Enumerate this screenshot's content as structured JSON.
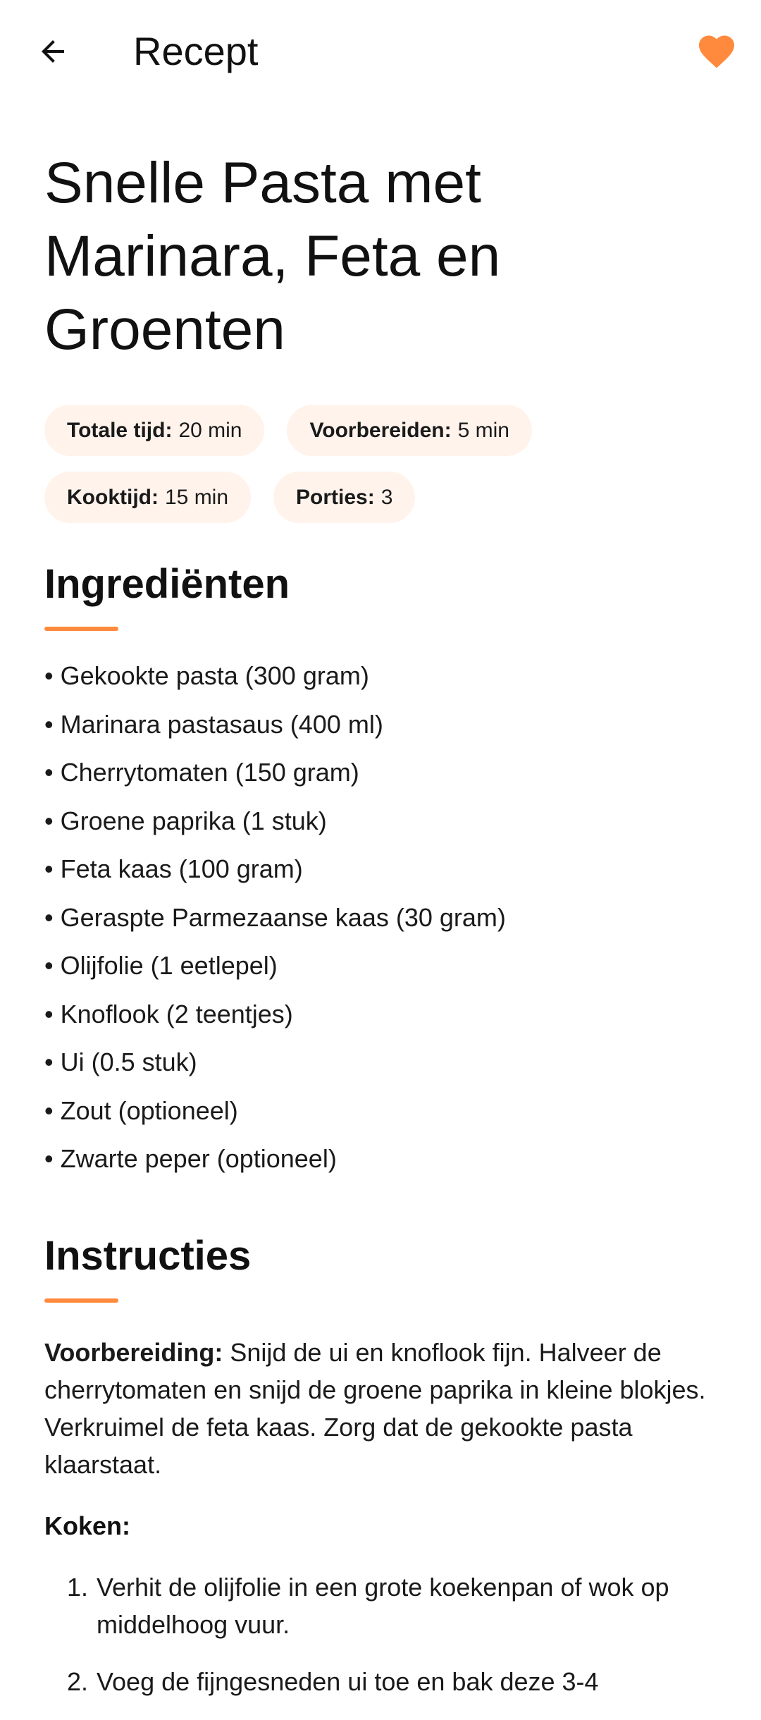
{
  "app_bar": {
    "title": "Recept",
    "back_icon": "arrow-left-icon",
    "favorite_icon": "heart-icon",
    "accent_color": "#ff8a3d"
  },
  "recipe": {
    "title": "Snelle Pasta met Marinara, Feta en Groenten"
  },
  "chips": [
    {
      "label": "Totale tijd:",
      "value": "20 min"
    },
    {
      "label": "Voorbereiden:",
      "value": "5 min"
    },
    {
      "label": "Kooktijd:",
      "value": "15 min"
    },
    {
      "label": "Porties:",
      "value": "3"
    }
  ],
  "ingredients": {
    "heading": "Ingrediënten",
    "bullet": "•",
    "items": [
      "Gekookte pasta (300 gram)",
      "Marinara pastasaus (400 ml)",
      "Cherrytomaten (150 gram)",
      "Groene paprika (1 stuk)",
      "Feta kaas (100 gram)",
      "Geraspte Parmezaanse kaas (30 gram)",
      "Olijfolie (1 eetlepel)",
      "Knoflook (2 teentjes)",
      "Ui (0.5 stuk)",
      "Zout (optioneel)",
      "Zwarte peper (optioneel)"
    ]
  },
  "instructions": {
    "heading": "Instructies",
    "preparation_label": "Voorbereiding:",
    "preparation_text": "Snijd de ui en knoflook fijn. Halveer de cherrytomaten en snijd de groene paprika in kleine blokjes. Verkruimel de feta kaas. Zorg dat de gekookte pasta klaarstaat.",
    "cooking_label": "Koken:",
    "steps": [
      {
        "num": "1.",
        "text": "Verhit de olijfolie in een grote koekenpan of wok op middelhoog vuur."
      },
      {
        "num": "2.",
        "text": "Voeg de fijngesneden ui toe en bak deze 3-4"
      }
    ]
  }
}
